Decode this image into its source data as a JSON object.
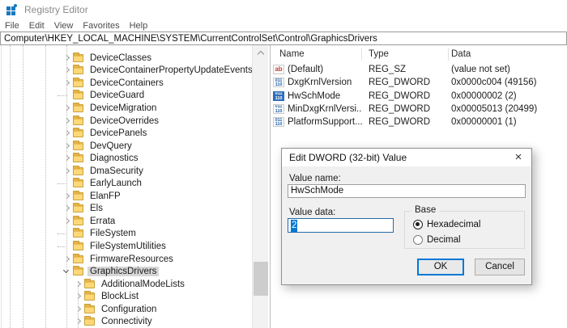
{
  "window": {
    "title": "Registry Editor"
  },
  "menu": {
    "items": [
      "File",
      "Edit",
      "View",
      "Favorites",
      "Help"
    ]
  },
  "address_bar": {
    "value": "Computer\\HKEY_LOCAL_MACHINE\\SYSTEM\\CurrentControlSet\\Control\\GraphicsDrivers"
  },
  "tree": {
    "items": [
      {
        "label": "DeviceClasses",
        "state": "collapsed",
        "level": 0
      },
      {
        "label": "DeviceContainerPropertyUpdateEvents",
        "state": "collapsed",
        "level": 0
      },
      {
        "label": "DeviceContainers",
        "state": "collapsed",
        "level": 0
      },
      {
        "label": "DeviceGuard",
        "state": "leaf",
        "level": 0
      },
      {
        "label": "DeviceMigration",
        "state": "collapsed",
        "level": 0
      },
      {
        "label": "DeviceOverrides",
        "state": "collapsed",
        "level": 0
      },
      {
        "label": "DevicePanels",
        "state": "collapsed",
        "level": 0
      },
      {
        "label": "DevQuery",
        "state": "collapsed",
        "level": 0
      },
      {
        "label": "Diagnostics",
        "state": "collapsed",
        "level": 0
      },
      {
        "label": "DmaSecurity",
        "state": "collapsed",
        "level": 0
      },
      {
        "label": "EarlyLaunch",
        "state": "leaf",
        "level": 0
      },
      {
        "label": "ElanFP",
        "state": "collapsed",
        "level": 0
      },
      {
        "label": "Els",
        "state": "collapsed",
        "level": 0
      },
      {
        "label": "Errata",
        "state": "collapsed",
        "level": 0
      },
      {
        "label": "FileSystem",
        "state": "leaf",
        "level": 0
      },
      {
        "label": "FileSystemUtilities",
        "state": "leaf",
        "level": 0
      },
      {
        "label": "FirmwareResources",
        "state": "collapsed",
        "level": 0
      },
      {
        "label": "GraphicsDrivers",
        "state": "expanded",
        "level": 0,
        "selected": true
      },
      {
        "label": "AdditionalModeLists",
        "state": "collapsed",
        "level": 1
      },
      {
        "label": "BlockList",
        "state": "collapsed",
        "level": 1
      },
      {
        "label": "Configuration",
        "state": "collapsed",
        "level": 1
      },
      {
        "label": "Connectivity",
        "state": "collapsed",
        "level": 1
      }
    ]
  },
  "values_pane": {
    "columns": [
      "Name",
      "Type",
      "Data"
    ],
    "rows": [
      {
        "name": "(Default)",
        "type": "REG_SZ",
        "data": "(value not set)",
        "icon": "string",
        "selected": false
      },
      {
        "name": "DxgKrnlVersion",
        "type": "REG_DWORD",
        "data": "0x0000c004 (49156)",
        "icon": "dword",
        "selected": false
      },
      {
        "name": "HwSchMode",
        "type": "REG_DWORD",
        "data": "0x00000002 (2)",
        "icon": "dword",
        "selected": true
      },
      {
        "name": "MinDxgKrnlVersi...",
        "type": "REG_DWORD",
        "data": "0x00005013 (20499)",
        "icon": "dword",
        "selected": false
      },
      {
        "name": "PlatformSupport...",
        "type": "REG_DWORD",
        "data": "0x00000001 (1)",
        "icon": "dword",
        "selected": false
      }
    ]
  },
  "icons": {
    "string_icon_text": "ab",
    "dword_icon_line1": "011",
    "dword_icon_line2": "110",
    "close_glyph": "×"
  },
  "dialog": {
    "title": "Edit DWORD (32-bit) Value",
    "value_name_label": "Value name:",
    "value_name": "HwSchMode",
    "value_data_label": "Value data:",
    "value_data": "2",
    "base_group_label": "Base",
    "radio_hexadecimal": "Hexadecimal",
    "radio_decimal": "Decimal",
    "ok_label": "OK",
    "cancel_label": "Cancel"
  },
  "colors": {
    "accent": "#0078d7",
    "selection_inactive": "#d6d6d6",
    "folder": "#fcd878"
  }
}
